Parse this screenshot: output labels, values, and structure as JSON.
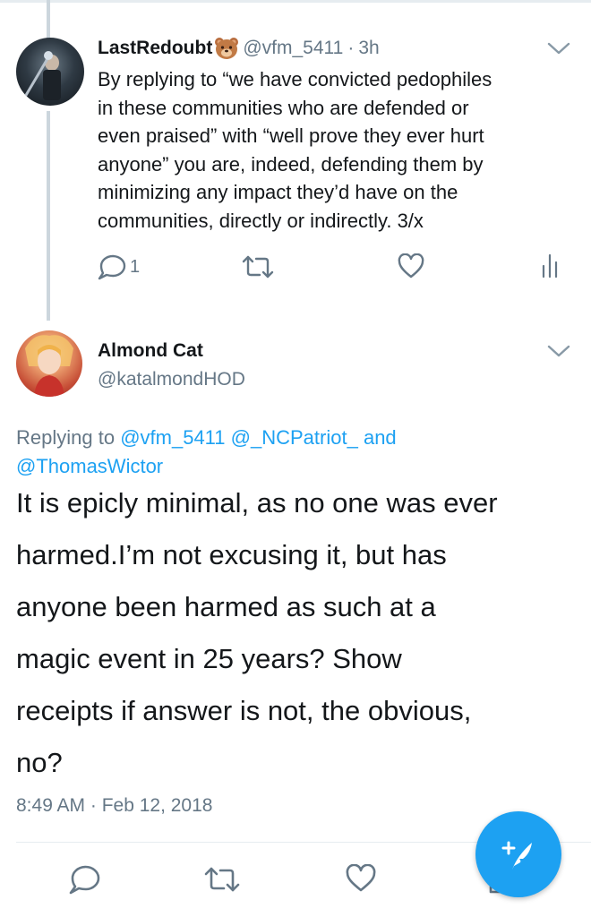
{
  "tweet1": {
    "name": "LastRedoubt",
    "handle": "@vfm_5411",
    "separator": "·",
    "time": "3h",
    "text": "By replying to “we have convicted pedophiles\nin these communities who are defended or\neven praised” with “well prove they ever hurt\nanyone” you are, indeed, defending them by\nminimizing any impact they’d have on the\ncommunities, directly or indirectly.  3/x",
    "reply_count": "1"
  },
  "tweet2": {
    "name": "Almond Cat",
    "handle": "@katalmondHOD",
    "replying_prefix": "Replying to",
    "mention1": "@vfm_5411",
    "mention2": "@_NCPatriot_",
    "replying_and": "and",
    "mention3": "@ThomasWictor",
    "text": "It is epicly minimal, as no one was ever\nharmed.I’m not excusing it, but has\nanyone been harmed as such at a\nmagic event in 25 years? Show\nreceipts if answer is not, the obvious,\nno?",
    "timestamp": "8:49 AM · Feb 12, 2018"
  },
  "colors": {
    "accent": "#1da1f2",
    "secondary_text": "#657786",
    "primary_text": "#14171a",
    "icon": "#657786"
  },
  "icons": {
    "tweet1_badge": "bear-emoji-icon",
    "reply": "reply-icon",
    "retweet": "retweet-icon",
    "like": "heart-icon",
    "stats": "analytics-icon",
    "menu": "chevron-down-icon",
    "compose": "compose-tweet-icon",
    "share": "share-icon"
  }
}
